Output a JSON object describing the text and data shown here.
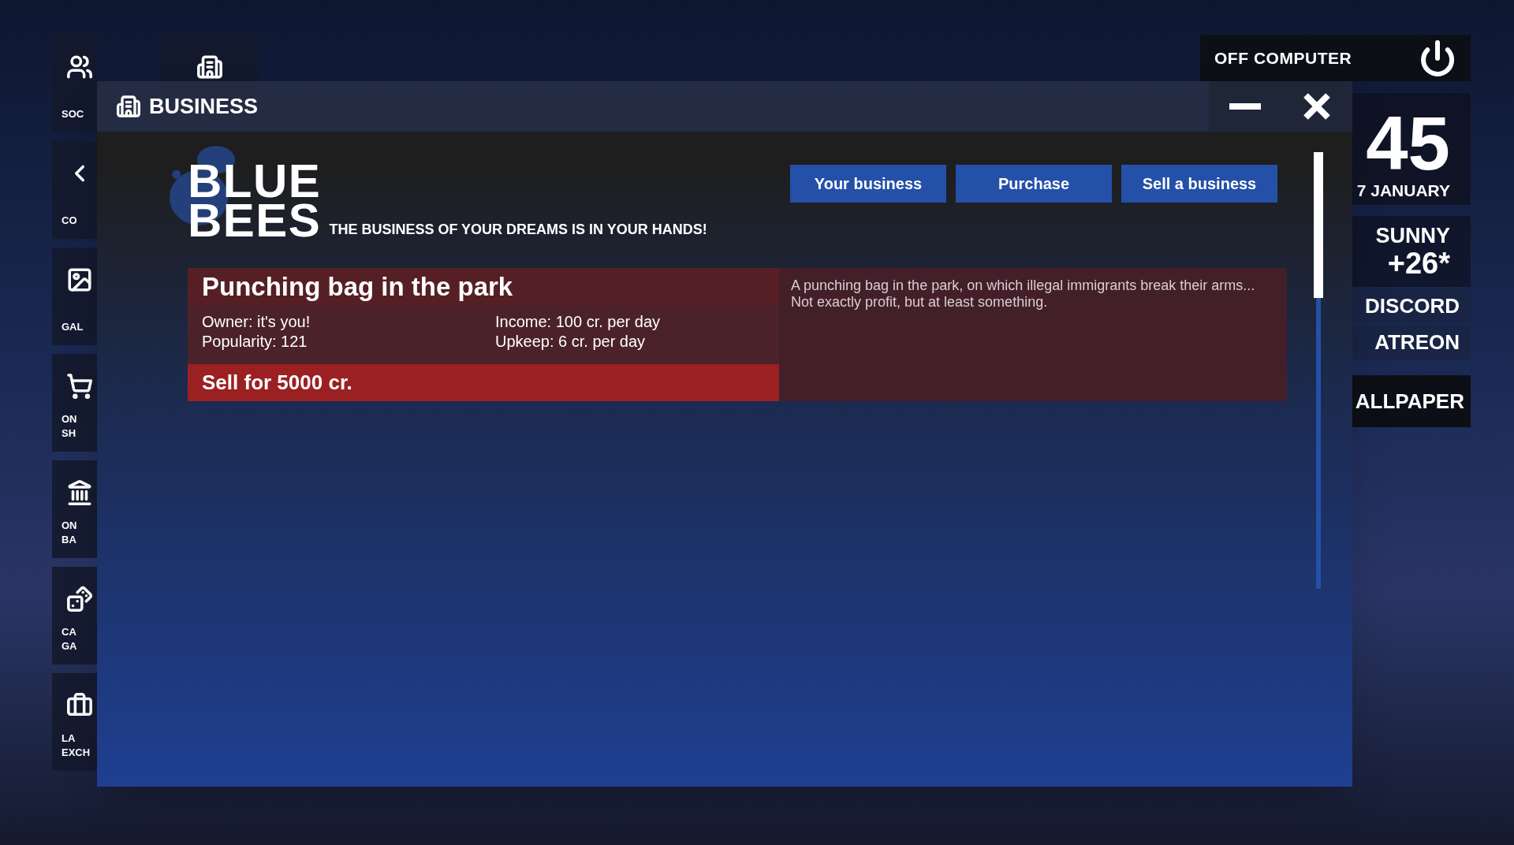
{
  "desktop": {
    "left_tiles": [
      {
        "lines": [
          "SOC"
        ]
      },
      {
        "lines": [
          "CO"
        ]
      },
      {
        "lines": [
          "GAL"
        ]
      },
      {
        "lines": [
          "ON",
          "SH"
        ]
      },
      {
        "lines": [
          "ON",
          "BA"
        ]
      },
      {
        "lines": [
          "CA",
          "GA"
        ]
      },
      {
        "lines": [
          "LA",
          "EXCH"
        ]
      }
    ],
    "off_button": "OFF COMPUTER",
    "clock": {
      "time": "45",
      "date": "7 JANUARY"
    },
    "weather": {
      "condition": "SUNNY",
      "temperature": "+26*"
    },
    "links": [
      "DISCORD",
      "ATREON"
    ],
    "wallpaper_button": "ALLPAPER"
  },
  "window": {
    "title": "BUSINESS",
    "logo": [
      "BLUE",
      "BEES"
    ],
    "tagline": "THE BUSINESS OF YOUR DREAMS IS IN YOUR HANDS!",
    "nav": [
      "Your business",
      "Purchase",
      "Sell a business"
    ],
    "businesses": [
      {
        "name": "Punching bag in the park",
        "owner": "Owner: it's you!",
        "popularity": "Popularity: 121",
        "income": "Income: 100 cr. per day",
        "upkeep": "Upkeep: 6 cr. per day",
        "sell": "Sell for 5000 cr.",
        "description": "A punching bag in the park, on which illegal immigrants break their arms... Not exactly profit, but at least something."
      }
    ]
  }
}
